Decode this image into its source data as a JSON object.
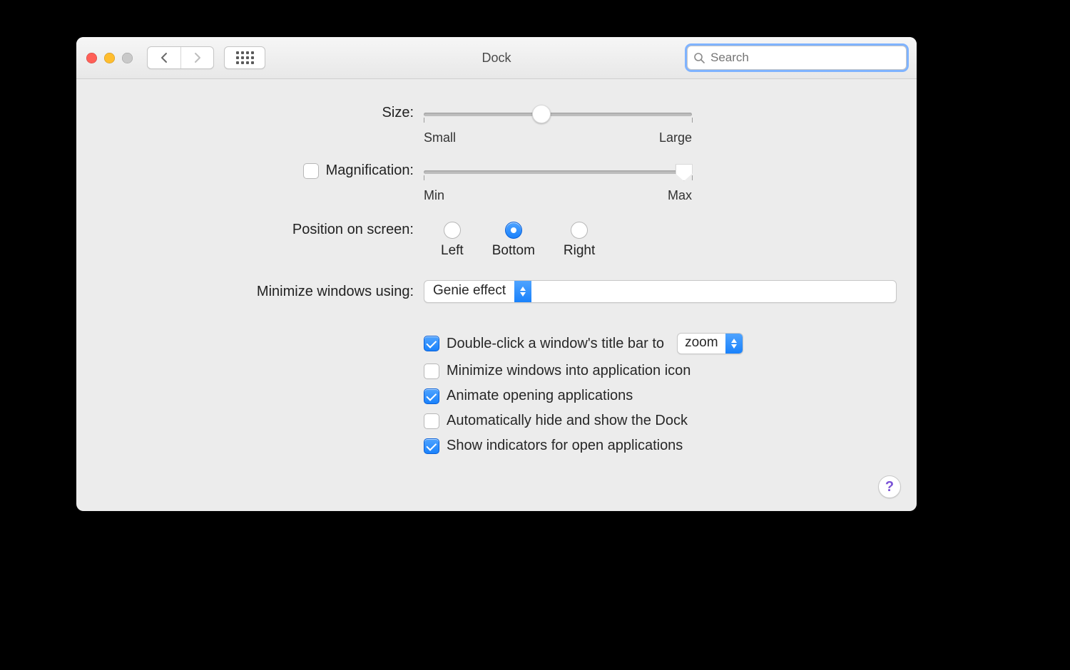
{
  "window": {
    "title": "Dock"
  },
  "search": {
    "placeholder": "Search"
  },
  "size": {
    "label": "Size:",
    "min_label": "Small",
    "max_label": "Large",
    "value_pct": 44
  },
  "magnification": {
    "label": "Magnification:",
    "checked": false,
    "min_label": "Min",
    "max_label": "Max",
    "value_pct": 100
  },
  "position": {
    "label": "Position on screen:",
    "options": {
      "left": "Left",
      "bottom": "Bottom",
      "right": "Right"
    },
    "selected": "bottom"
  },
  "minimize_effect": {
    "label": "Minimize windows using:",
    "value": "Genie effect"
  },
  "options": {
    "double_click": {
      "checked": true,
      "label": "Double-click a window's title bar to",
      "value": "zoom"
    },
    "minimize_into_app": {
      "checked": false,
      "label": "Minimize windows into application icon"
    },
    "animate_opening": {
      "checked": true,
      "label": "Animate opening applications"
    },
    "autohide": {
      "checked": false,
      "label": "Automatically hide and show the Dock"
    },
    "show_indicators": {
      "checked": true,
      "label": "Show indicators for open applications"
    }
  },
  "help_glyph": "?"
}
